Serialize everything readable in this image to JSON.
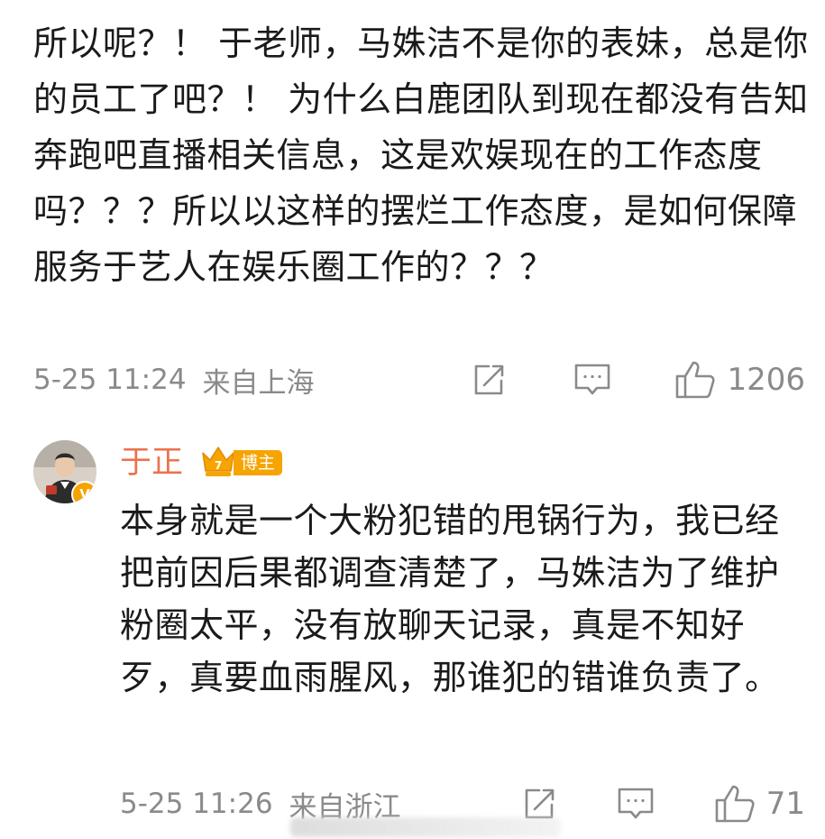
{
  "comment": {
    "text": "所以呢？！ 于老师，马姝洁不是你的表妹，总是你的员工了吧？！ 为什么白鹿团队到现在都没有告知奔跑吧直播相关信息，这是欢娱现在的工作态度吗？？？所以以这样的摆烂工作态度，是如何保障服务于艺人在娱乐圈工作的？？？",
    "time": "5-25 11:24",
    "location": "来自上海",
    "like_count": "1206",
    "icons": [
      "share-icon",
      "comment-icon",
      "like-icon"
    ]
  },
  "reply": {
    "author": "于正",
    "verified_badge": "V",
    "badge_label": "博主",
    "text": "本身就是一个大粉犯错的甩锅行为，我已经把前因后果都调查清楚了，马姝洁为了维护粉圈太平，没有放聊天记录，真是不知好歹，真要血雨腥风，那谁犯的错谁负责了。",
    "time": "5-25 11:26",
    "location": "来自浙江",
    "like_count": "71",
    "icons": [
      "share-icon",
      "comment-icon",
      "like-icon"
    ]
  },
  "colors": {
    "text": "#1a1a1a",
    "meta": "#8a8a8a",
    "author": "#eb7350",
    "badge": "#f6a500"
  }
}
